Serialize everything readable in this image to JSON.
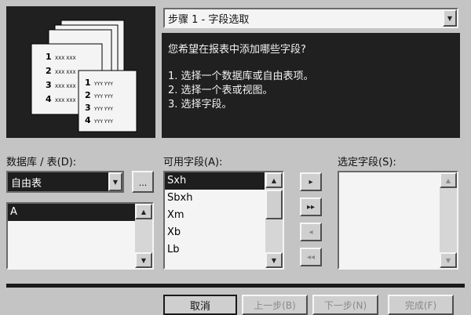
{
  "step_selector": {
    "value": "步骤 1 - 字段选取"
  },
  "instructions": {
    "question": "您希望在报表中添加哪些字段?",
    "steps": [
      "1. 选择一个数据库或自由表项。",
      "2. 选择一个表或视图。",
      "3. 选择字段。"
    ]
  },
  "illustration": {
    "rows": [
      {
        "num": "1",
        "text": "YYY YYY"
      },
      {
        "num": "2",
        "text": "YYY YYY"
      },
      {
        "num": "3",
        "text": "YYY YYY"
      },
      {
        "num": "4",
        "text": "YYY YYY"
      }
    ],
    "back_rows": [
      {
        "num": "1",
        "text": "XXX XXX"
      },
      {
        "num": "2",
        "text": "XXX XXX"
      },
      {
        "num": "3",
        "text": "XXX XXX"
      },
      {
        "num": "4",
        "text": "XXX XXX"
      }
    ]
  },
  "database": {
    "label": "数据库 / 表(D):",
    "combo_value": "自由表",
    "browse_label": "...",
    "tables": [
      "A"
    ]
  },
  "available": {
    "label": "可用字段(A):",
    "fields": [
      "Sxh",
      "Sbxh",
      "Xm",
      "Xb",
      "Lb"
    ]
  },
  "selected": {
    "label": "选定字段(S):"
  },
  "move_buttons": [
    {
      "glyph": "▸"
    },
    {
      "glyph": "▸▸"
    },
    {
      "glyph": "◂"
    },
    {
      "glyph": "◂◂"
    }
  ],
  "footer": {
    "cancel": "取消",
    "back": "上一步(B)",
    "next": "下一步(N)",
    "finish": "完成(F)"
  }
}
